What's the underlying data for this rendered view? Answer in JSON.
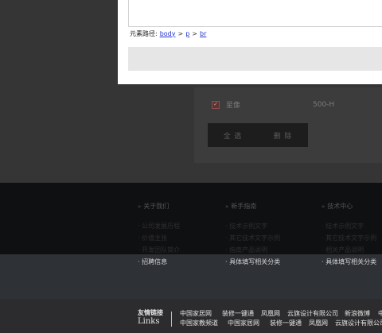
{
  "editor_dialog": {
    "path_label": "元素路径:",
    "path": [
      "body",
      "p",
      "br"
    ],
    "separator": ">"
  },
  "file_list": {
    "rows": [
      {
        "name": "星像",
        "size": "500-H",
        "checked": true
      }
    ],
    "select_all_label": "全 选",
    "delete_label": "删 除"
  },
  "footer_columns": [
    {
      "title": "关于我们",
      "items": [
        "公司发展历程",
        "价值主张",
        "开发团队简介",
        "招聘信息"
      ]
    },
    {
      "title": "新手指南",
      "items": [
        "技术示例文字",
        "其它技术文字示例",
        "指南产品说明",
        "具体填写相关分类"
      ]
    },
    {
      "title": "技术中心",
      "items": [
        "技术示例文字",
        "其它技术文字示例",
        "相关产品说明",
        "具体填写相关分类"
      ]
    }
  ],
  "friendly_links": {
    "title_cn": "友情链接",
    "title_en": "Links",
    "row1": [
      "中国家居网",
      "装修一键通",
      "凤凰网",
      "云旗设计有限公司",
      "新浪微博",
      "中"
    ],
    "row2": [
      "中国家教频道",
      "中国家居网",
      "装修一键通",
      "凤凰网",
      "云旗设计有限公司"
    ]
  }
}
